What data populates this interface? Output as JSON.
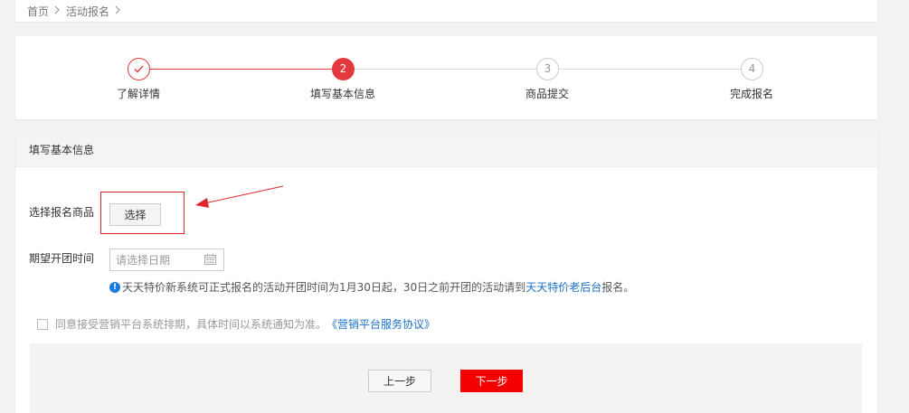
{
  "breadcrumb": {
    "home": "首页",
    "current": "活动报名"
  },
  "steps": [
    {
      "number": "1",
      "label": "了解详情",
      "state": "done"
    },
    {
      "number": "2",
      "label": "填写基本信息",
      "state": "current"
    },
    {
      "number": "3",
      "label": "商品提交",
      "state": "pending"
    },
    {
      "number": "4",
      "label": "完成报名",
      "state": "pending"
    }
  ],
  "form": {
    "section_title": "填写基本信息",
    "product_label": "选择报名商品",
    "select_button": "选择",
    "date_label": "期望开团时间",
    "date_placeholder": "请选择日期",
    "notice_text": "天天特价新系统可正式报名的活动开团时间为1月30日起，30日之前开团的活动请到",
    "notice_link": "天天特价老后台",
    "notice_suffix": "报名。",
    "agree_text": "同意接受营销平台系统排期，具体时间以系统通知为准。",
    "agree_link": "《营销平台服务协议》",
    "agree_checked": false
  },
  "buttons": {
    "prev": "上一步",
    "next": "下一步"
  },
  "colors": {
    "accent_red": "#e4393c",
    "next_button": "#f40000",
    "link_blue": "#1a6fc9",
    "annotation_red": "#d9252a"
  },
  "icons": {
    "step_done": "check-icon",
    "breadcrumb_separator": "chevron-right-icon",
    "date": "calendar-icon",
    "notice": "info-icon"
  }
}
